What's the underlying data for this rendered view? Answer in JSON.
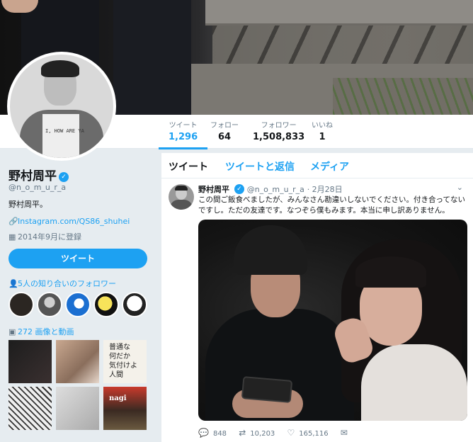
{
  "stats": [
    {
      "label": "ツイート",
      "value": "1,296"
    },
    {
      "label": "フォロー",
      "value": "64"
    },
    {
      "label": "フォロワー",
      "value": "1,508,833"
    },
    {
      "label": "いいね",
      "value": "1"
    }
  ],
  "profile": {
    "name": "野村周平",
    "handle": "@n_o_m_u_r_a",
    "bio": "野村周平。",
    "link": "Instagram.com/QS86_shuhei",
    "joined": "2014年9月に登録",
    "tweet_button": "ツイート"
  },
  "followers_you_know": "5人の知り合いのフォロワー",
  "media_label": "272 画像と動画",
  "media_thumbs": [
    {
      "text": ""
    },
    {
      "text": ""
    },
    {
      "text": "普通な\n何だか\n気付けよ\n人間"
    },
    {
      "text": ""
    },
    {
      "text": ""
    },
    {
      "text": "nagi"
    }
  ],
  "tabs": [
    "ツイート",
    "ツイートと返信",
    "メディア"
  ],
  "tweet": {
    "name": "野村周平",
    "handle": "@n_o_m_u_r_a",
    "date": "· 2月28日",
    "text": "この間ご飯食べましたが、みんなさん勘違いしないでください。付き合ってないですし。ただの友達です。なつぞら僕もみます。本当に申し訳ありません。",
    "replies": "848",
    "retweets": "10,203",
    "likes": "165,116"
  },
  "colors": {
    "accent": "#1da1f2",
    "background": "#e6ecf0"
  }
}
